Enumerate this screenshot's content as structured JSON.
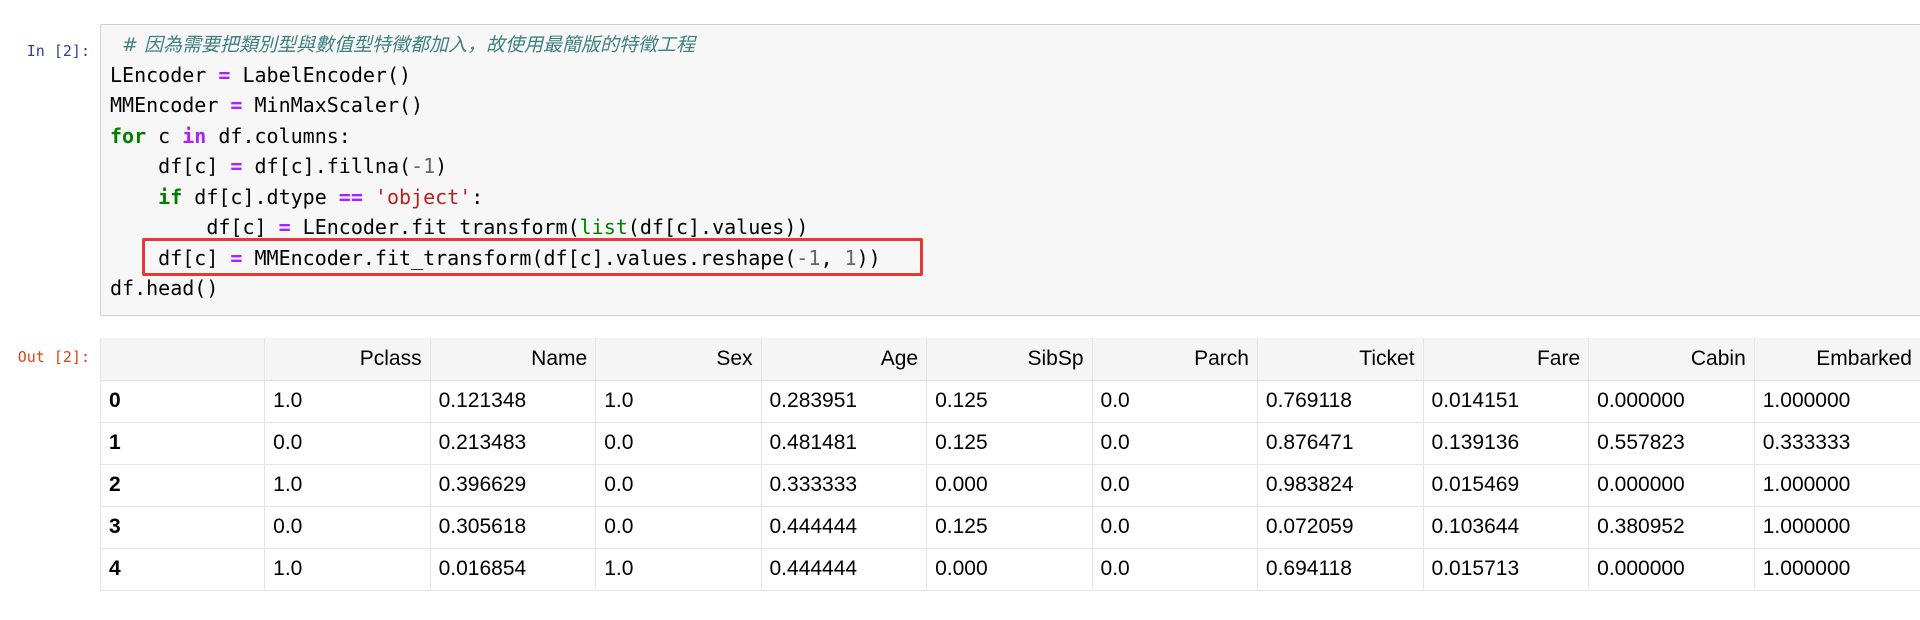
{
  "prompts": {
    "in": "In [2]:",
    "out": "Out [2]:"
  },
  "code": {
    "comment": "# 因為需要把類別型與數值型特徵都加入，故使用最簡版的特徵工程",
    "line2": {
      "a": "LEncoder ",
      "eq": "=",
      "b": " LabelEncoder()"
    },
    "line3": {
      "a": "MMEncoder ",
      "eq": "=",
      "b": " MinMaxScaler()"
    },
    "line4": {
      "kw1": "for",
      "a": " c ",
      "kw2": "in",
      "b": " df.columns:"
    },
    "line5": {
      "a": "    df[c] ",
      "eq": "=",
      "b": " df[c].fillna(",
      "num": "-1",
      "c": ")"
    },
    "line6": {
      "kw": "    if",
      "a": " df[c].dtype ",
      "eq": "==",
      "str": " 'object'",
      "b": ":"
    },
    "line7": {
      "a": "        df[c] ",
      "eq": "=",
      "b": " LEncoder.fit_transform(",
      "nb": "list",
      "c": "(df[c].values))"
    },
    "line8": {
      "a": "    df[c] ",
      "eq": "=",
      "b": " MMEncoder.fit_transform(df[c].values.reshape(",
      "num1": "-1",
      "sep": ", ",
      "num2": "1",
      "c": "))"
    },
    "line9": {
      "a": "df.head()"
    }
  },
  "table": {
    "columns": [
      "Pclass",
      "Name",
      "Sex",
      "Age",
      "SibSp",
      "Parch",
      "Ticket",
      "Fare",
      "Cabin",
      "Embarked"
    ],
    "rows": [
      {
        "index": "0",
        "cells": [
          "1.0",
          "0.121348",
          "1.0",
          "0.283951",
          "0.125",
          "0.0",
          "0.769118",
          "0.014151",
          "0.000000",
          "1.000000"
        ]
      },
      {
        "index": "1",
        "cells": [
          "0.0",
          "0.213483",
          "0.0",
          "0.481481",
          "0.125",
          "0.0",
          "0.876471",
          "0.139136",
          "0.557823",
          "0.333333"
        ]
      },
      {
        "index": "2",
        "cells": [
          "1.0",
          "0.396629",
          "0.0",
          "0.333333",
          "0.000",
          "0.0",
          "0.983824",
          "0.015469",
          "0.000000",
          "1.000000"
        ]
      },
      {
        "index": "3",
        "cells": [
          "0.0",
          "0.305618",
          "0.0",
          "0.444444",
          "0.125",
          "0.0",
          "0.072059",
          "0.103644",
          "0.380952",
          "1.000000"
        ]
      },
      {
        "index": "4",
        "cells": [
          "1.0",
          "0.016854",
          "1.0",
          "0.444444",
          "0.000",
          "0.0",
          "0.694118",
          "0.015713",
          "0.000000",
          "1.000000"
        ]
      }
    ]
  },
  "colors": {
    "highlight": "#e53935",
    "in_prompt": "#303f9f",
    "out_prompt": "#d84315"
  }
}
